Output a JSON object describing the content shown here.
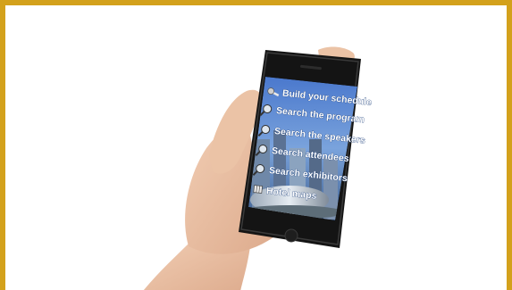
{
  "theme": {
    "border_color": "#d3a11c",
    "phone_body": "#141414",
    "screen_sky": "#4f7fd1"
  },
  "menu": {
    "items": [
      {
        "label": "Build your schedule",
        "icon": "pin-icon"
      },
      {
        "label": "Search the program",
        "icon": "magnifier-icon"
      },
      {
        "label": "Search the speakers",
        "icon": "magnifier-icon"
      },
      {
        "label": "Search attendees",
        "icon": "magnifier-icon"
      },
      {
        "label": "Search exhibitors",
        "icon": "magnifier-icon"
      },
      {
        "label": "Hotel maps",
        "icon": "map-icon"
      }
    ]
  }
}
